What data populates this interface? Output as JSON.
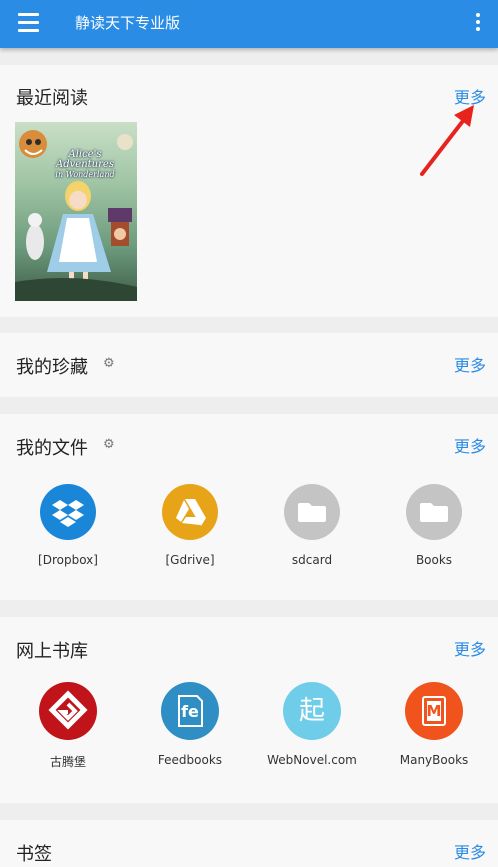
{
  "appbar": {
    "title": "静读天下专业版"
  },
  "recent": {
    "title": "最近阅读",
    "more": "更多",
    "book": {
      "cover_title_1": "Alice's",
      "cover_title_2": "Adventures",
      "cover_title_3": "in Wonderland"
    }
  },
  "favorites": {
    "title": "我的珍藏",
    "more": "更多"
  },
  "files": {
    "title": "我的文件",
    "more": "更多",
    "items": [
      {
        "label": "[Dropbox]",
        "color": "#1a86d8",
        "icon": "dropbox-icon"
      },
      {
        "label": "[Gdrive]",
        "color": "#e7a418",
        "icon": "google-drive-icon"
      },
      {
        "label": "sdcard",
        "color": "#c4c4c4",
        "icon": "folder-icon"
      },
      {
        "label": "Books",
        "color": "#c4c4c4",
        "icon": "folder-icon"
      }
    ]
  },
  "library": {
    "title": "网上书库",
    "more": "更多",
    "items": [
      {
        "label": "古腾堡",
        "color": "#c1131a",
        "icon": "gutenberg-icon"
      },
      {
        "label": "Feedbooks",
        "color": "#2f8fc4",
        "icon": "feedbooks-icon",
        "glyph": "fe"
      },
      {
        "label": "WebNovel.com",
        "color": "#6fcdea",
        "icon": "webnovel-icon",
        "glyph": "起"
      },
      {
        "label": "ManyBooks",
        "color": "#f0541c",
        "icon": "manybooks-icon",
        "glyph": "M"
      }
    ]
  },
  "bookmarks": {
    "title": "书签",
    "more": "更多"
  }
}
